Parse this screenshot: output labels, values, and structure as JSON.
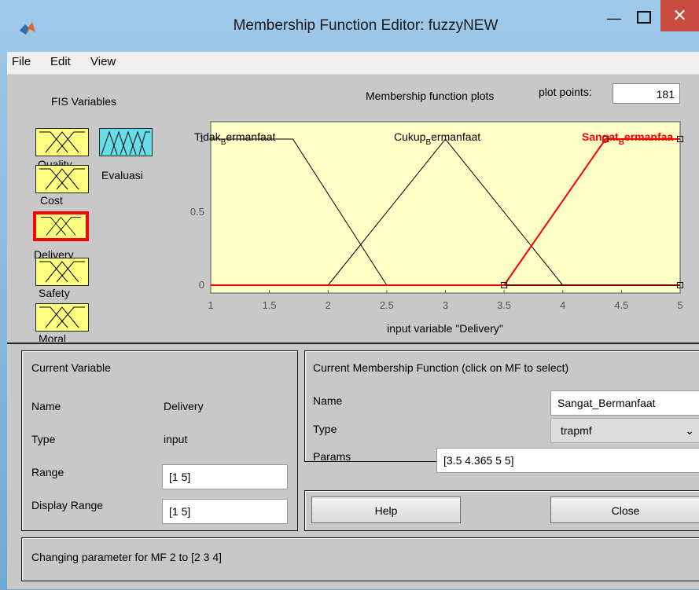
{
  "window": {
    "title": "Membership Function Editor: fuzzyNEW"
  },
  "menu": {
    "items": [
      "File",
      "Edit",
      "View"
    ]
  },
  "fis": {
    "heading": "FIS Variables",
    "inputs": [
      "Quality",
      "Cost",
      "Delivery",
      "Safety",
      "Moral"
    ],
    "outputs": [
      "Evaluasi"
    ],
    "selected": "Delivery"
  },
  "plot": {
    "heading": "Membership function plots",
    "points_label": "plot points:",
    "points_value": "181",
    "xlabel": "input variable \"Delivery\"",
    "mf_labels": [
      "Tidak_Bermanfaat",
      "Cukup_Bermanfaat",
      "Sangat_Bermanfaat"
    ]
  },
  "current_variable": {
    "heading": "Current Variable",
    "name_label": "Name",
    "name_value": "Delivery",
    "type_label": "Type",
    "type_value": "input",
    "range_label": "Range",
    "range_value": "[1 5]",
    "display_range_label": "Display Range",
    "display_range_value": "[1 5]"
  },
  "current_mf": {
    "heading": "Current Membership Function (click on MF to select)",
    "name_label": "Name",
    "name_value": "Sangat_Bermanfaat",
    "type_label": "Type",
    "type_value": "trapmf",
    "params_label": "Params",
    "params_value": "[3.5 4.365 5 5]"
  },
  "buttons": {
    "help": "Help",
    "close": "Close"
  },
  "status": {
    "text": "Changing parameter for MF 2 to [2 3 4]"
  },
  "colors": {
    "plot_bg": "#ffffc8",
    "selected_mf": "#ff0000",
    "input_box": "#ffff80",
    "output_box": "#66dde8",
    "close_btn": "#c74b3f"
  },
  "chart_data": {
    "type": "line",
    "xlim": [
      1,
      5
    ],
    "ylim": [
      0,
      1
    ],
    "xticks": [
      "1",
      "1.5",
      "2",
      "2.5",
      "3",
      "3.5",
      "4",
      "4.5",
      "5"
    ],
    "yticks": [
      "0",
      "0.5",
      "1"
    ],
    "xlabel": "input variable \"Delivery\"",
    "series": [
      {
        "name": "Tidak_Bermanfaat",
        "x": [
          1,
          1.7,
          2.5
        ],
        "y": [
          1,
          1,
          0
        ],
        "color": "#000000"
      },
      {
        "name": "Cukup_Bermanfaat",
        "x": [
          2,
          3,
          4
        ],
        "y": [
          0,
          1,
          0
        ],
        "color": "#000000"
      },
      {
        "name": "Sangat_Bermanfaat",
        "x": [
          3.5,
          4.365,
          5,
          5
        ],
        "y": [
          0,
          1,
          1,
          1
        ],
        "color": "#ff0000"
      }
    ]
  }
}
